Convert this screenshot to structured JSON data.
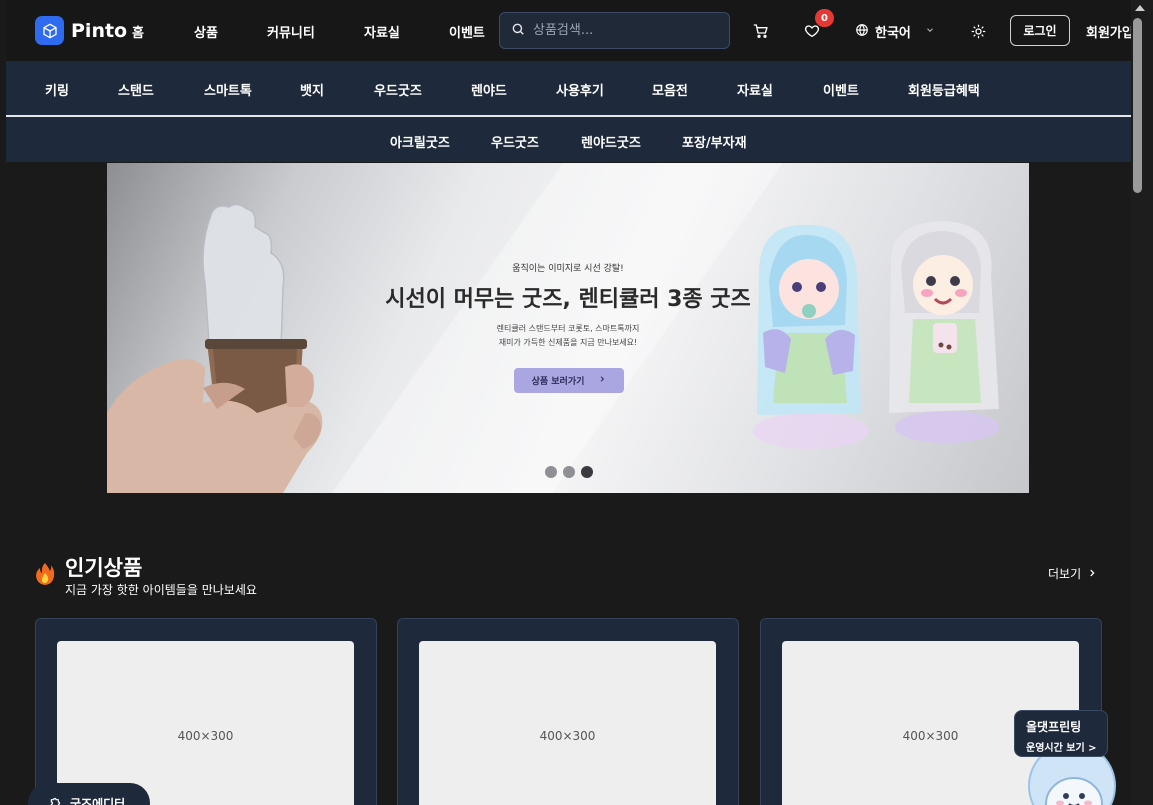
{
  "header": {
    "logo_text": "Pinto",
    "nav": [
      "홈",
      "상품",
      "커뮤니티",
      "자료실",
      "이벤트"
    ],
    "search_placeholder": "상품검색...",
    "wishlist_count": "0",
    "language": "한국어",
    "login_label": "로그인",
    "signup_label": "회원가입"
  },
  "categories": [
    "키링",
    "스탠드",
    "스마트톡",
    "뱃지",
    "우드굿즈",
    "렌야드",
    "사용후기",
    "모음전",
    "자료실",
    "이벤트",
    "회원등급혜택"
  ],
  "subcategories": [
    "아크릴굿즈",
    "우드굿즈",
    "렌야드굿즈",
    "포장/부자재"
  ],
  "banner": {
    "overline": "움직이는 이미지로 시선 강탈!",
    "title": "시선이 머무는 굿즈, 렌티큘러 3종 굿즈",
    "desc_line1": "렌티큘러 스탠드부터 코롯토, 스마트톡까지",
    "desc_line2": "재미가 가득한 신제품을 지금 만나보세요!",
    "cta": "상품 보러가기",
    "slide_count": 3,
    "active_slide": 3
  },
  "popular": {
    "title": "인기상품",
    "subtitle": "지금 가장 핫한 아이템들을 만나보세요",
    "more_label": "더보기",
    "products": [
      {
        "image_label": "400×300"
      },
      {
        "image_label": "400×300"
      },
      {
        "image_label": "400×300"
      }
    ]
  },
  "floating": {
    "title": "올댓프린팅",
    "subtitle": "운영시간 보기 >",
    "editor_label": "굿즈에디터"
  },
  "colors": {
    "page_bg": "#1a1a1a",
    "nav_bg": "#1e293b",
    "brand_blue": "#2f6bf0",
    "badge_red": "#e53935",
    "cta_purple": "#a9a6e2"
  }
}
